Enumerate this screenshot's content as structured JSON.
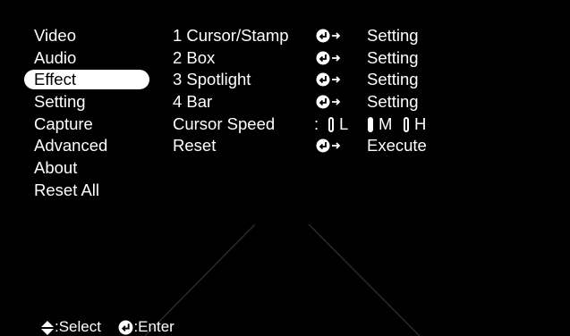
{
  "menu": {
    "items": [
      {
        "label": "Video"
      },
      {
        "label": "Audio"
      },
      {
        "label": "Effect",
        "selected": true
      },
      {
        "label": "Setting"
      },
      {
        "label": "Capture"
      },
      {
        "label": "Advanced"
      },
      {
        "label": "About"
      },
      {
        "label": "Reset All"
      }
    ]
  },
  "effect": {
    "rows": [
      {
        "label": "1 Cursor/Stamp",
        "icon": "enter-arrow-icon",
        "value": "Setting"
      },
      {
        "label": "2 Box",
        "icon": "enter-arrow-icon",
        "value": "Setting"
      },
      {
        "label": "3 Spotlight",
        "icon": "enter-arrow-icon",
        "value": "Setting"
      },
      {
        "label": "4 Bar",
        "icon": "enter-arrow-icon",
        "value": "Setting"
      }
    ],
    "cursor_speed": {
      "label": "Cursor Speed",
      "separator": ":",
      "options": [
        "L",
        "M",
        "H"
      ],
      "selected": "M"
    },
    "reset": {
      "label": "Reset",
      "icon": "enter-arrow-icon",
      "value": "Execute"
    }
  },
  "footer": {
    "select_hint": ":Select",
    "enter_hint": ":Enter",
    "select_icon": "up-down-icon",
    "enter_icon": "enter-icon"
  },
  "colors": {
    "background": "#000000",
    "text": "#ffffff",
    "highlight": "#ffffff"
  }
}
